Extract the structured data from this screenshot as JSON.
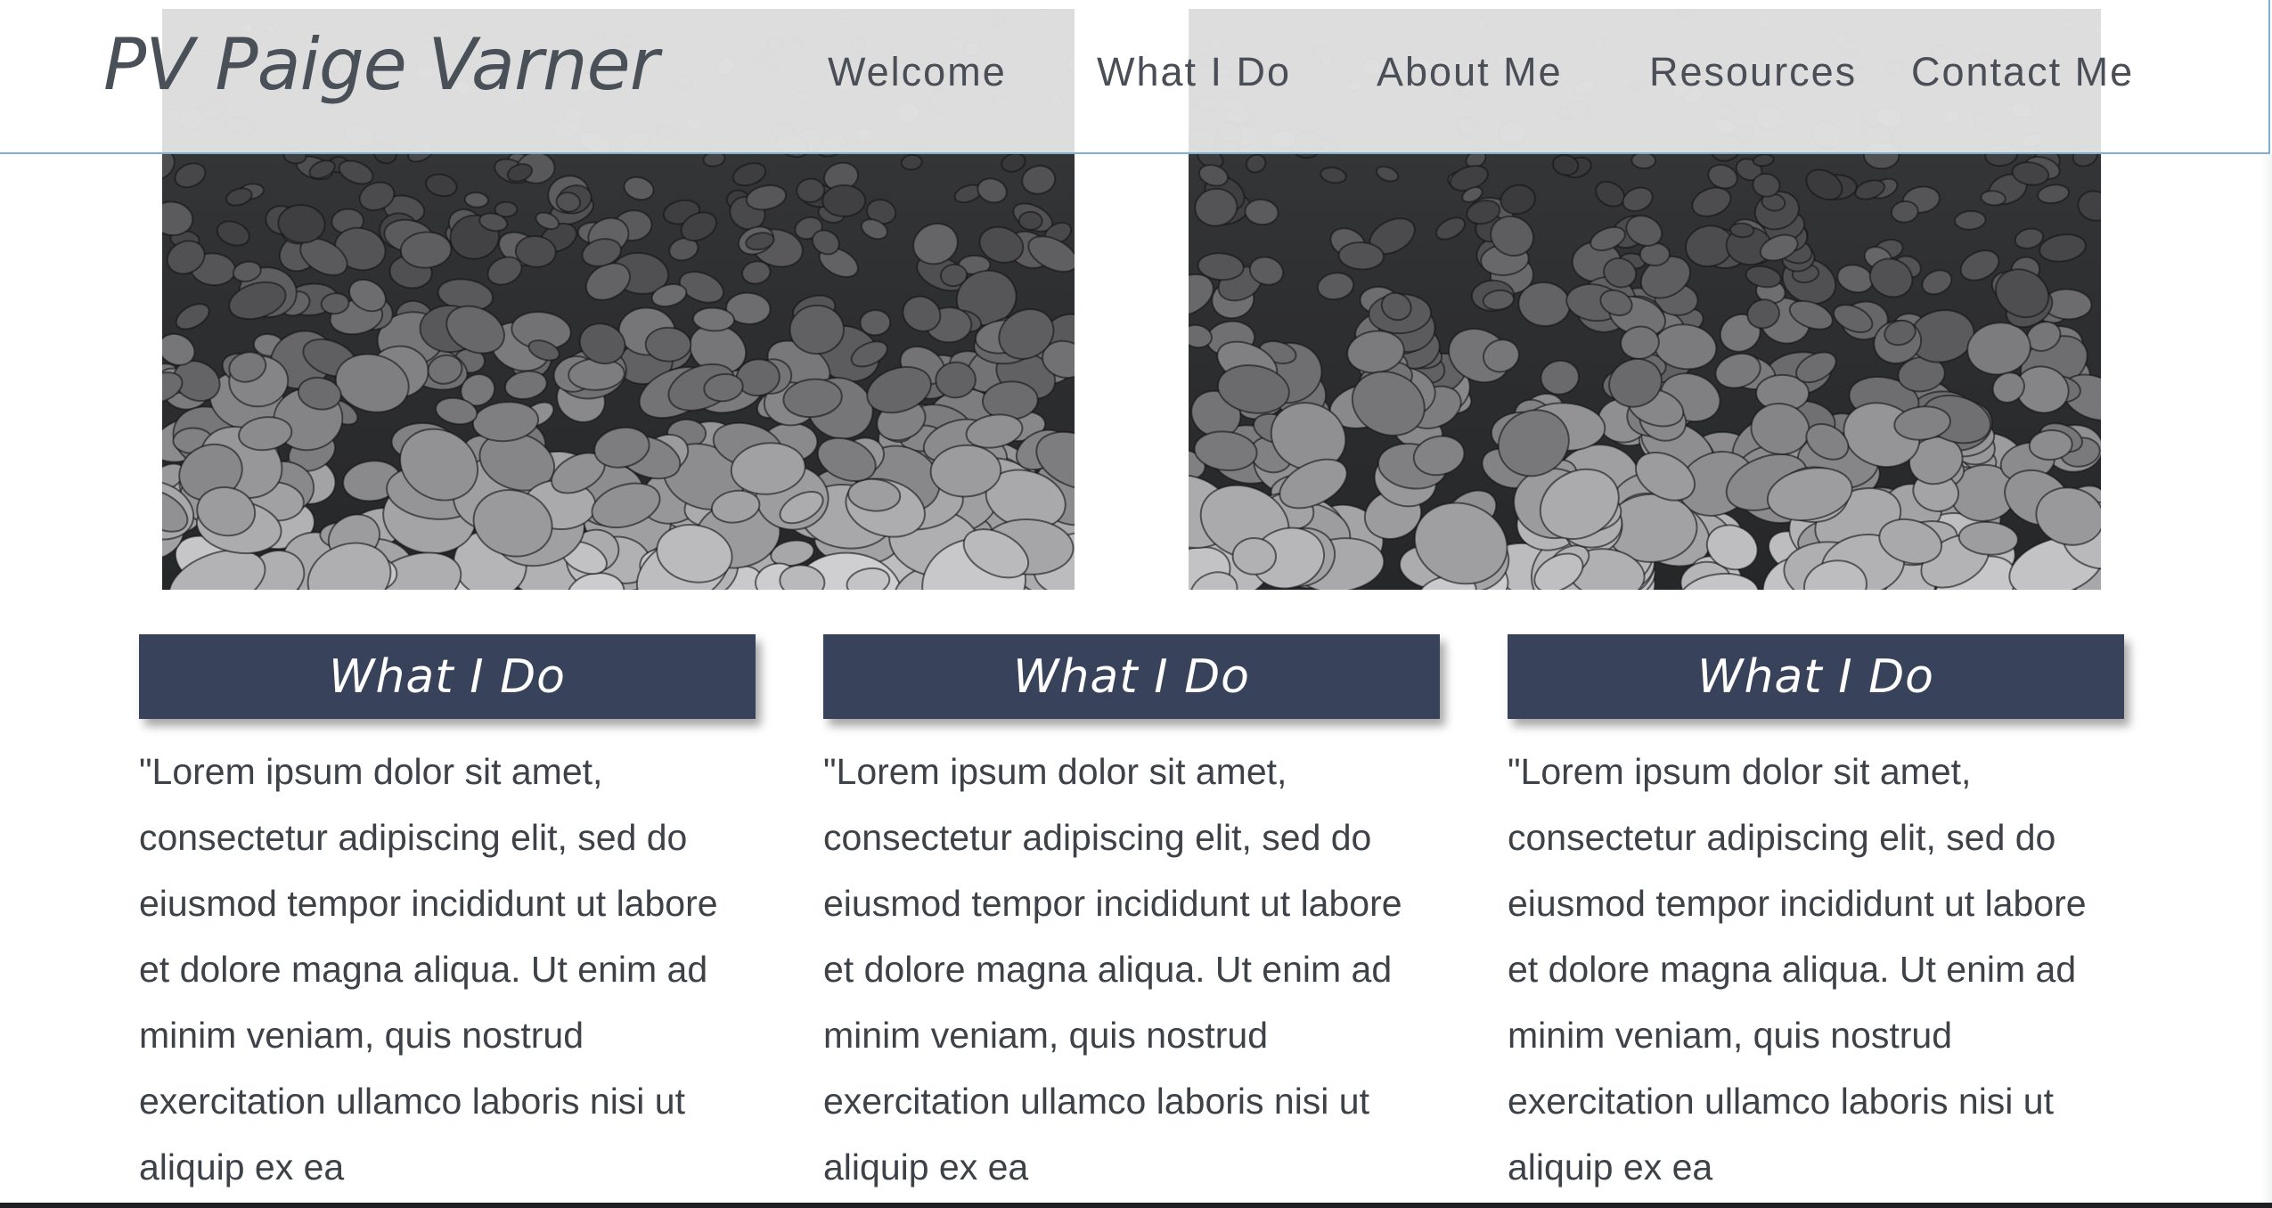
{
  "site": {
    "logo": "PV Paige Varner"
  },
  "nav": {
    "items": [
      {
        "label": "Welcome"
      },
      {
        "label": "What I Do"
      },
      {
        "label": "About Me"
      },
      {
        "label": "Resources"
      },
      {
        "label": "Contact Me"
      }
    ]
  },
  "hero": {
    "images": [
      {
        "alt": "dark stones photo"
      },
      {
        "alt": "dark stones photo"
      }
    ]
  },
  "columns": [
    {
      "title": "What I Do",
      "text": "\"Lorem ipsum dolor sit amet, consectetur adipiscing elit, sed do eiusmod tempor incididunt ut labore et dolore magna aliqua. Ut enim ad minim veniam, quis nostrud exercitation ullamco laboris nisi ut aliquip ex ea"
    },
    {
      "title": "What I Do",
      "text": "\"Lorem ipsum dolor sit amet, consectetur adipiscing elit, sed do eiusmod tempor incididunt ut labore et dolore magna aliqua. Ut enim ad minim veniam, quis nostrud exercitation ullamco laboris nisi ut aliquip ex ea"
    },
    {
      "title": "What I Do",
      "text": "\"Lorem ipsum dolor sit amet, consectetur adipiscing elit, sed do eiusmod tempor incididunt ut labore et dolore magna aliqua. Ut enim ad minim veniam, quis nostrud exercitation ullamco laboris nisi ut aliquip ex ea"
    }
  ],
  "colors": {
    "banner": "#38435b",
    "header_border": "#7fb0d2",
    "text": "#3d4249"
  }
}
